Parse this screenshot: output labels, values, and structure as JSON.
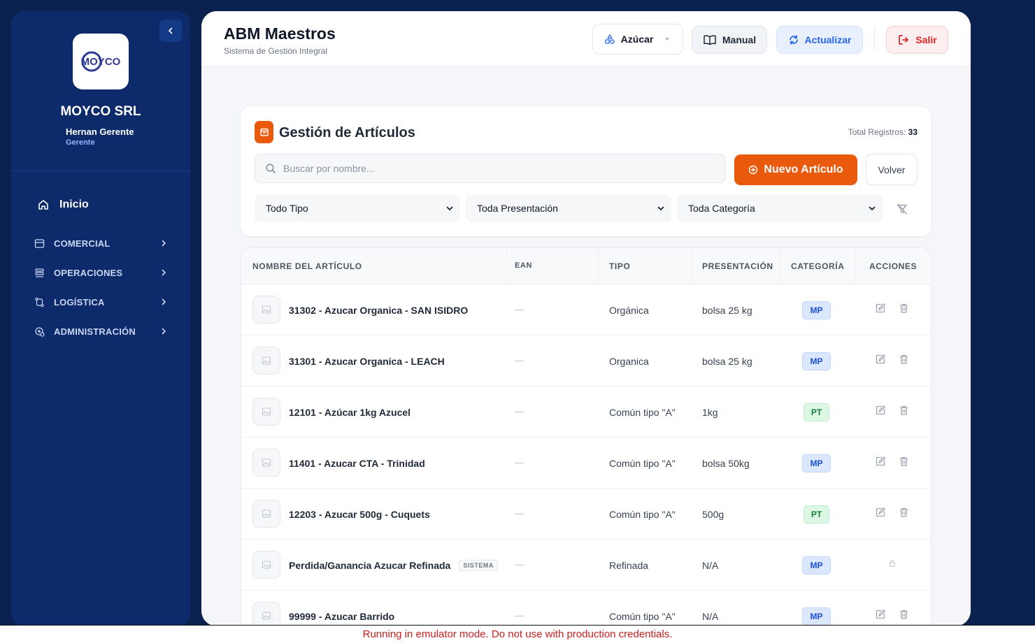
{
  "sidebar": {
    "company": "MOYCO SRL",
    "logo_text": "MOYCO",
    "user_name": "Hernan Gerente",
    "user_role": "Gerente",
    "home_label": "Inicio",
    "items": [
      {
        "label": "COMERCIAL",
        "icon": "store-icon"
      },
      {
        "label": "OPERACIONES",
        "icon": "operations-icon"
      },
      {
        "label": "LOGÍSTICA",
        "icon": "route-icon"
      },
      {
        "label": "ADMINISTRACIÓN",
        "icon": "admin-gear-icon"
      }
    ]
  },
  "header": {
    "title": "ABM Maestros",
    "subtitle": "Sistema de Gestión Integral",
    "product_selector": "Azúcar",
    "manual_label": "Manual",
    "refresh_label": "Actualizar",
    "logout_label": "Salir"
  },
  "card": {
    "title": "Gestión de Artículos",
    "total_label": "Total Registros:",
    "total_value": "33",
    "search_placeholder": "Buscar por nombre...",
    "new_button": "Nuevo Artículo",
    "back_button": "Volver",
    "filters": {
      "tipo": "Todo Tipo",
      "presentacion": "Toda Presentación",
      "categoria": "Toda Categoría"
    }
  },
  "table": {
    "columns": [
      "NOMBRE DEL ARTÍCULO",
      "EAN",
      "TIPO",
      "PRESENTACIÓN",
      "CATEGORÍA",
      "ACCIONES"
    ],
    "rows": [
      {
        "name": "31302 - Azucar Organica - SAN ISIDRO",
        "ean": "—",
        "tipo": "Orgánica",
        "presentacion": "bolsa 25 kg",
        "categoria": "MP",
        "badge": "",
        "locked": false
      },
      {
        "name": "31301 - Azucar Organica - LEACH",
        "ean": "—",
        "tipo": "Organica",
        "presentacion": "bolsa 25 kg",
        "categoria": "MP",
        "badge": "",
        "locked": false
      },
      {
        "name": "12101 - Azúcar 1kg Azucel",
        "ean": "—",
        "tipo": "Común tipo \"A\"",
        "presentacion": "1kg",
        "categoria": "PT",
        "badge": "",
        "locked": false
      },
      {
        "name": "11401 - Azucar CTA - Trinidad",
        "ean": "—",
        "tipo": "Común tipo \"A\"",
        "presentacion": "bolsa 50kg",
        "categoria": "MP",
        "badge": "",
        "locked": false
      },
      {
        "name": "12203 - Azucar 500g - Cuquets",
        "ean": "—",
        "tipo": "Común tipo \"A\"",
        "presentacion": "500g",
        "categoria": "PT",
        "badge": "",
        "locked": false
      },
      {
        "name": "Perdida/Ganancia Azucar Refinada",
        "ean": "—",
        "tipo": "Refinada",
        "presentacion": "N/A",
        "categoria": "MP",
        "badge": "SISTEMA",
        "locked": true
      },
      {
        "name": "99999 - Azucar Barrido",
        "ean": "—",
        "tipo": "Común tipo \"A\"",
        "presentacion": "N/A",
        "categoria": "MP",
        "badge": "",
        "locked": false
      }
    ]
  },
  "footer": {
    "warning": "Running in emulator mode. Do not use with production credentials."
  }
}
